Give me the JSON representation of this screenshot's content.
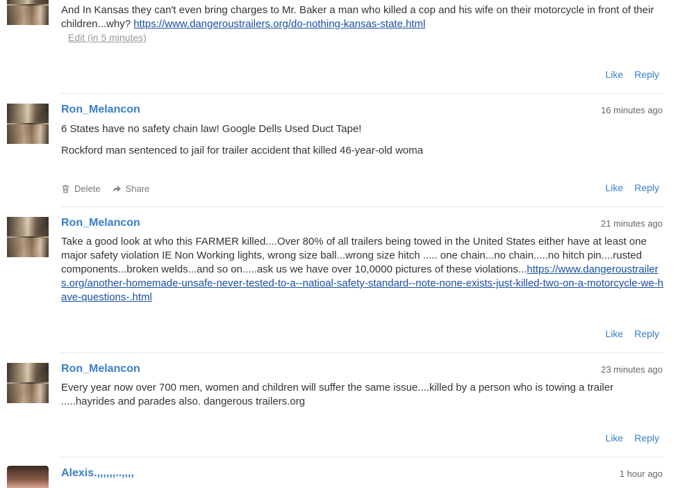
{
  "comments": [
    {
      "author": "",
      "time": "",
      "body_text": "And In Kansas they can't even bring charges to Mr. Baker a man who killed a cop and his wife on their motorcycle in front of their children...why? ",
      "link": "https://www.dangeroustrailers.org/do-nothing-kansas-state.html",
      "edit_label": "Edit (in 5 minutes)",
      "like_label": "Like",
      "reply_label": "Reply"
    },
    {
      "author": "Ron_Melancon",
      "time": "16 minutes ago",
      "para1": "6 States have no safety chain law! Google  Dells Used Duct Tape!",
      "para2": "Rockford man sentenced to jail for trailer accident that killed 46-year-old woma",
      "delete_label": "Delete",
      "share_label": "Share",
      "like_label": "Like",
      "reply_label": "Reply"
    },
    {
      "author": "Ron_Melancon",
      "time": "21 minutes ago",
      "body_text": "Take a good look at who this FARMER killed....Over 80% of all trailers being towed in the United States either have at least one major safety violation IE Non Working lights, wrong size ball...wrong size hitch ..... one chain...no chain.....no hitch pin....rusted components...broken welds...and so on.....ask us we have over 10,0000 pictures of these violations...",
      "link": "https://www.dangeroustrailers.org/another-homemade-unsafe-never-tested-to-a--natioal-safety-standard--note-none-exists-just-killed-two-on-a-motorcycle-we-have-questions-.html",
      "like_label": "Like",
      "reply_label": "Reply"
    },
    {
      "author": "Ron_Melancon",
      "time": "23 minutes ago",
      "body_text": "Every year now over 700 men, women and children will suffer the same issue....killed by a person who is towing a trailer .....hayrides and parades also.  dangerous trailers.org",
      "like_label": "Like",
      "reply_label": "Reply"
    },
    {
      "author": "Alexis.,,,,,,..,,,,",
      "time": "1 hour ago"
    }
  ],
  "icons": {
    "delete": "trash-icon",
    "share": "share-arrow-icon"
  },
  "colors": {
    "author": "#3a7ec8",
    "link": "#1a4fa0",
    "divider": "#e6e6e6"
  }
}
